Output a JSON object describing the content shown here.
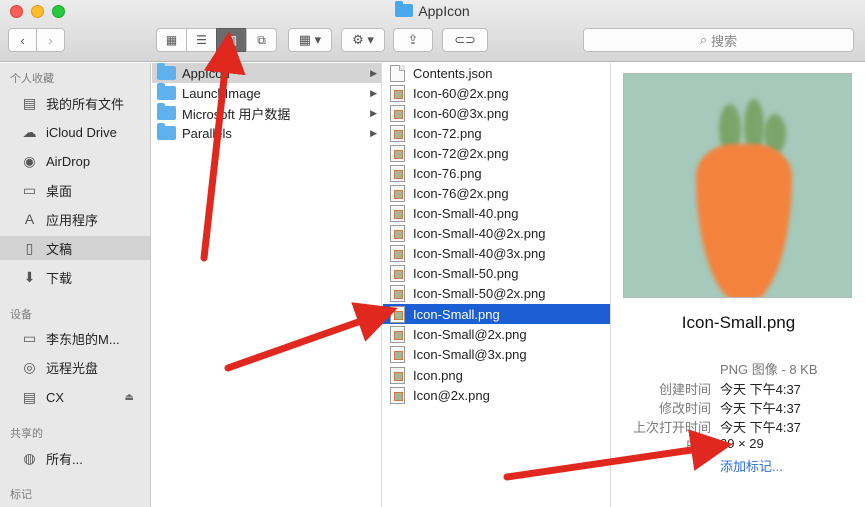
{
  "window": {
    "title": "AppIcon"
  },
  "toolbar": {
    "back_icon": "‹",
    "forward_icon": "›",
    "view_icons": [
      "▦",
      "☰",
      "▥",
      "⧉"
    ],
    "arrange_icon": "▦ ▾",
    "action_icon": "⚙ ▾",
    "share_icon": "⇪",
    "tag_icon": "⊂⊃",
    "search_placeholder": "搜索"
  },
  "sidebar": {
    "favorites_header": "个人收藏",
    "favorites": [
      {
        "label": "我的所有文件",
        "icon": "▤"
      },
      {
        "label": "iCloud Drive",
        "icon": "☁"
      },
      {
        "label": "AirDrop",
        "icon": "◉"
      },
      {
        "label": "桌面",
        "icon": "▭"
      },
      {
        "label": "应用程序",
        "icon": "A"
      },
      {
        "label": "文稿",
        "icon": "▯"
      },
      {
        "label": "下载",
        "icon": "⬇"
      }
    ],
    "devices_header": "设备",
    "devices": [
      {
        "label": "李东旭的M...",
        "icon": "▭"
      },
      {
        "label": "远程光盘",
        "icon": "◎"
      },
      {
        "label": "CX",
        "icon": "▤",
        "eject": "⏏"
      }
    ],
    "shared_header": "共享的",
    "shared": [
      {
        "label": "所有...",
        "icon": "◍"
      }
    ],
    "tags_header": "标记"
  },
  "column1": {
    "items": [
      {
        "label": "AppIcon",
        "chevron": "▶"
      },
      {
        "label": "LaunchImage",
        "chevron": "▶"
      },
      {
        "label": "Microsoft 用户数据",
        "chevron": "▶"
      },
      {
        "label": "Parallels",
        "chevron": "▶"
      }
    ]
  },
  "column2": {
    "items": [
      "Contents.json",
      "Icon-60@2x.png",
      "Icon-60@3x.png",
      "Icon-72.png",
      "Icon-72@2x.png",
      "Icon-76.png",
      "Icon-76@2x.png",
      "Icon-Small-40.png",
      "Icon-Small-40@2x.png",
      "Icon-Small-40@3x.png",
      "Icon-Small-50.png",
      "Icon-Small-50@2x.png",
      "Icon-Small.png",
      "Icon-Small@2x.png",
      "Icon-Small@3x.png",
      "Icon.png",
      "Icon@2x.png"
    ]
  },
  "preview": {
    "name": "Icon-Small.png",
    "kind": "PNG 图像 - 8 KB",
    "created_label": "创建时间",
    "created_value": "今天 下午4:37",
    "modified_label": "修改时间",
    "modified_value": "今天 下午4:37",
    "opened_label": "上次打开时间",
    "opened_value": "今天 下午4:37",
    "size_label": "尺寸",
    "size_value": "29 × 29",
    "add_tags": "添加标记..."
  },
  "colors": {
    "selection_blue": "#1c5fd4",
    "annotation_red": "#e0281e",
    "link_blue": "#2a6fe0"
  }
}
